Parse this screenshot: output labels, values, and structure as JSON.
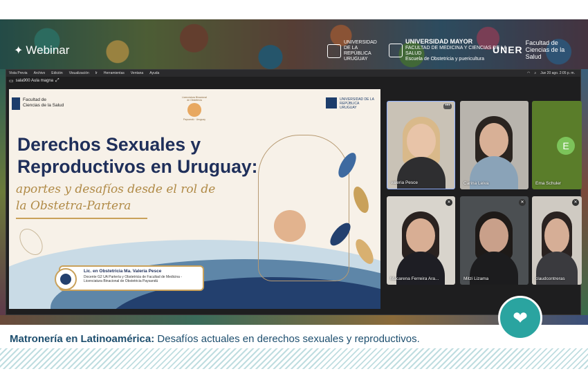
{
  "banner": {
    "webinar_label": "Webinar",
    "logos": {
      "udelar": "UNIVERSIDAD DE LA REPÚBLICA URUGUAY",
      "umayor_name": "UNIVERSIDAD MAYOR",
      "umayor_sub": "FACULTAD DE MEDICINA Y CIENCIAS DE LA SALUD",
      "umayor_dept": "Escuela de Obstetricia y puericultura",
      "uner_name": "UNER",
      "uner_faculty": "Facultad de Ciencias de la Salud"
    }
  },
  "zoom": {
    "menu": [
      "Vista Previa",
      "Archivo",
      "Edición",
      "Visualización",
      "Ir",
      "Herramientas",
      "Ventana",
      "Ayuda"
    ],
    "clock": "Jue 20 ago. 2:05 p. m.",
    "room_name": "sala900 Aula magna",
    "slide": {
      "header_left": "Facultad de Ciencias de la Salud",
      "header_center": "Licenciatura Binacional de Obstetricia",
      "header_center_sub": "Paysandú · Uruguay",
      "header_right": "UNIVERSIDAD DE LA REPÚBLICA URUGUAY",
      "title_line1": "Derechos Sexuales y",
      "title_line2": "Reproductivos en Uruguay:",
      "subtitle_line1": "aportes y desafíos desde el rol de",
      "subtitle_line2": "la Obstetra-Partera",
      "presenter_name": "Lic. en Obstetricia Ma. Valeria Pesce",
      "presenter_desc": "Docente G2 UA Partería y Obstetricia de Facultad de Medicina - Licenciatura Binacional de Obstetricia Paysandú"
    },
    "participants": [
      {
        "name": "valeria Pesce"
      },
      {
        "name": "Carina Leiva"
      },
      {
        "name": "Ema Schuler",
        "initial": "E"
      },
      {
        "name": "Macarena Ferreira Ara..."
      },
      {
        "name": "Mitzi Lizama"
      },
      {
        "name": "claudcontreras"
      }
    ]
  },
  "caption": {
    "bold": "Matronería en Latinoamérica:",
    "rest": " Desafíos actuales en derechos sexuales y reproductivos."
  },
  "colors": {
    "title_navy": "#1f2f5a",
    "subtitle_gold": "#b08a46",
    "caption_blue": "#1d4e6e",
    "badge_teal": "#2aa4a0"
  }
}
